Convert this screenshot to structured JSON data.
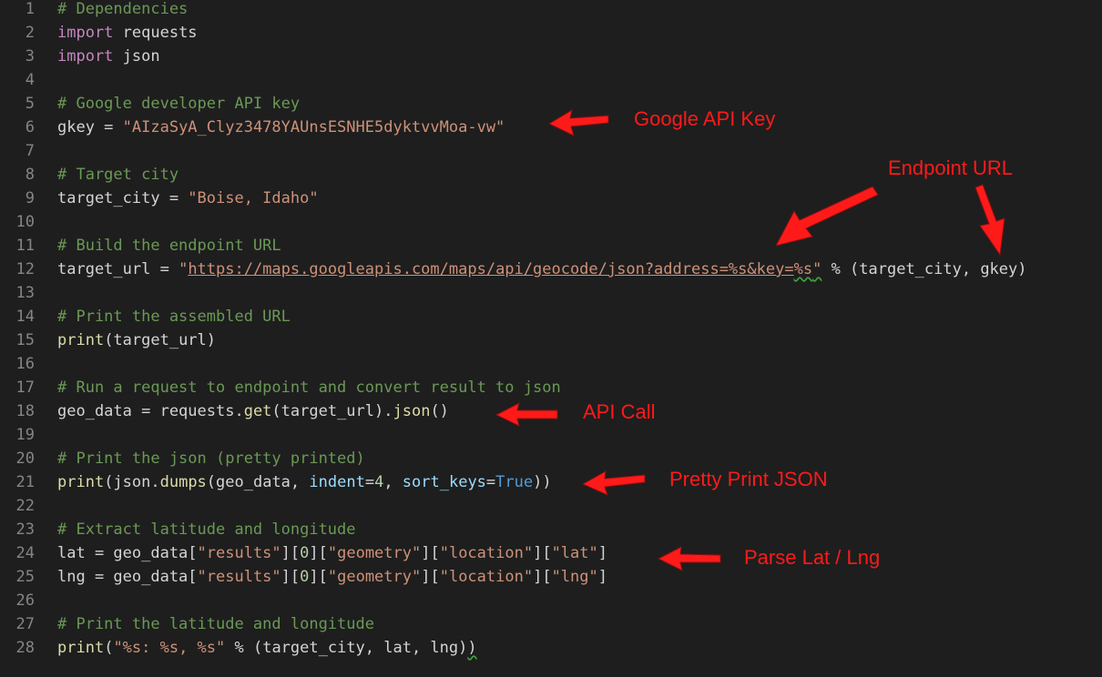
{
  "editor": {
    "lines": [
      {
        "n": "1",
        "tokens": [
          {
            "t": "# Dependencies",
            "c": "comment"
          }
        ]
      },
      {
        "n": "2",
        "tokens": [
          {
            "t": "import",
            "c": "keyword"
          },
          {
            "t": " requests",
            "c": "plain"
          }
        ]
      },
      {
        "n": "3",
        "tokens": [
          {
            "t": "import",
            "c": "keyword"
          },
          {
            "t": " json",
            "c": "plain"
          }
        ]
      },
      {
        "n": "4",
        "tokens": []
      },
      {
        "n": "5",
        "tokens": [
          {
            "t": "# Google developer API key",
            "c": "comment"
          }
        ]
      },
      {
        "n": "6",
        "tokens": [
          {
            "t": "gkey = ",
            "c": "plain"
          },
          {
            "t": "\"AIzaSyA_Clyz3478YAUnsESNHE5dyktvvMoa-vw\"",
            "c": "string"
          }
        ]
      },
      {
        "n": "7",
        "tokens": []
      },
      {
        "n": "8",
        "tokens": [
          {
            "t": "# Target city",
            "c": "comment"
          }
        ]
      },
      {
        "n": "9",
        "tokens": [
          {
            "t": "target_city = ",
            "c": "plain"
          },
          {
            "t": "\"Boise, Idaho\"",
            "c": "string"
          }
        ]
      },
      {
        "n": "10",
        "tokens": []
      },
      {
        "n": "11",
        "tokens": [
          {
            "t": "# Build the endpoint URL",
            "c": "comment"
          }
        ]
      },
      {
        "n": "12",
        "tokens": [
          {
            "t": "target_url = ",
            "c": "plain"
          },
          {
            "t": "\"",
            "c": "string"
          },
          {
            "t": "https://maps.googleapis.com/maps/api/geocode/json?address=%s&key=",
            "c": "url"
          },
          {
            "t": "%s",
            "c": "url squiggle"
          },
          {
            "t": "\"",
            "c": "string squiggle"
          },
          {
            "t": " % (target_city, gkey)",
            "c": "plain"
          }
        ]
      },
      {
        "n": "13",
        "tokens": []
      },
      {
        "n": "14",
        "tokens": [
          {
            "t": "# Print the assembled URL",
            "c": "comment"
          }
        ]
      },
      {
        "n": "15",
        "tokens": [
          {
            "t": "print",
            "c": "func"
          },
          {
            "t": "(target_url)",
            "c": "plain"
          }
        ]
      },
      {
        "n": "16",
        "tokens": []
      },
      {
        "n": "17",
        "tokens": [
          {
            "t": "# Run a request to endpoint and convert result to json",
            "c": "comment"
          }
        ]
      },
      {
        "n": "18",
        "tokens": [
          {
            "t": "geo_data = requests.",
            "c": "plain"
          },
          {
            "t": "get",
            "c": "func"
          },
          {
            "t": "(target_url).",
            "c": "plain"
          },
          {
            "t": "json",
            "c": "func"
          },
          {
            "t": "()",
            "c": "plain"
          }
        ]
      },
      {
        "n": "19",
        "tokens": []
      },
      {
        "n": "20",
        "tokens": [
          {
            "t": "# Print the json (pretty printed)",
            "c": "comment"
          }
        ]
      },
      {
        "n": "21",
        "tokens": [
          {
            "t": "print",
            "c": "func"
          },
          {
            "t": "(json.",
            "c": "plain"
          },
          {
            "t": "dumps",
            "c": "func"
          },
          {
            "t": "(geo_data, ",
            "c": "plain"
          },
          {
            "t": "indent",
            "c": "param"
          },
          {
            "t": "=",
            "c": "plain"
          },
          {
            "t": "4",
            "c": "number"
          },
          {
            "t": ", ",
            "c": "plain"
          },
          {
            "t": "sort_keys",
            "c": "param"
          },
          {
            "t": "=",
            "c": "plain"
          },
          {
            "t": "True",
            "c": "const"
          },
          {
            "t": "))",
            "c": "plain"
          }
        ]
      },
      {
        "n": "22",
        "tokens": []
      },
      {
        "n": "23",
        "tokens": [
          {
            "t": "# Extract latitude and longitude",
            "c": "comment"
          }
        ]
      },
      {
        "n": "24",
        "tokens": [
          {
            "t": "lat = geo_data[",
            "c": "plain"
          },
          {
            "t": "\"results\"",
            "c": "string"
          },
          {
            "t": "][",
            "c": "plain"
          },
          {
            "t": "0",
            "c": "number"
          },
          {
            "t": "][",
            "c": "plain"
          },
          {
            "t": "\"geometry\"",
            "c": "string"
          },
          {
            "t": "][",
            "c": "plain"
          },
          {
            "t": "\"location\"",
            "c": "string"
          },
          {
            "t": "][",
            "c": "plain"
          },
          {
            "t": "\"lat\"",
            "c": "string"
          },
          {
            "t": "]",
            "c": "plain"
          }
        ]
      },
      {
        "n": "25",
        "tokens": [
          {
            "t": "lng = geo_data[",
            "c": "plain"
          },
          {
            "t": "\"results\"",
            "c": "string"
          },
          {
            "t": "][",
            "c": "plain"
          },
          {
            "t": "0",
            "c": "number"
          },
          {
            "t": "][",
            "c": "plain"
          },
          {
            "t": "\"geometry\"",
            "c": "string"
          },
          {
            "t": "][",
            "c": "plain"
          },
          {
            "t": "\"location\"",
            "c": "string"
          },
          {
            "t": "][",
            "c": "plain"
          },
          {
            "t": "\"lng\"",
            "c": "string"
          },
          {
            "t": "]",
            "c": "plain"
          }
        ]
      },
      {
        "n": "26",
        "tokens": []
      },
      {
        "n": "27",
        "tokens": [
          {
            "t": "# Print the latitude and longitude",
            "c": "comment"
          }
        ]
      },
      {
        "n": "28",
        "tokens": [
          {
            "t": "print",
            "c": "func"
          },
          {
            "t": "(",
            "c": "plain"
          },
          {
            "t": "\"%s: %s, %s\"",
            "c": "string"
          },
          {
            "t": " % (target_city, lat, lng)",
            "c": "plain"
          },
          {
            "t": ")",
            "c": "plain squiggle"
          }
        ]
      }
    ]
  },
  "annotations": {
    "google_api_key": "Google API Key",
    "endpoint_url": "Endpoint URL",
    "api_call": "API Call",
    "pretty_print_json": "Pretty Print JSON",
    "parse_lat_lng": "Parse Lat / Lng",
    "arrow_color": "#ff1a1a"
  },
  "theme": {
    "background": "#1e1e1e",
    "line_number": "#858585",
    "comment": "#6a9955",
    "keyword": "#c586c0",
    "string": "#ce9178",
    "function": "#dcdcaa",
    "parameter": "#9cdcfe",
    "constant": "#569cd6",
    "number": "#b5cea8",
    "plain": "#d4d4d4"
  }
}
